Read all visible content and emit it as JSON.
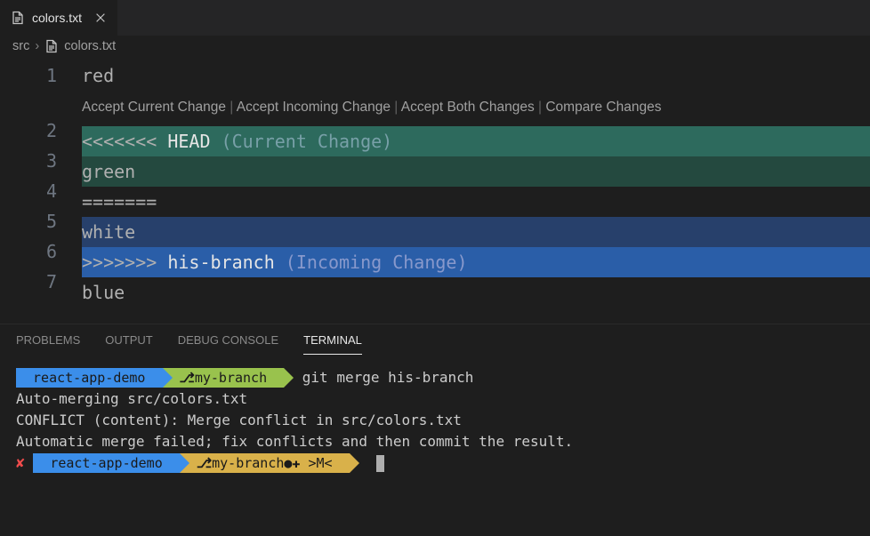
{
  "tab": {
    "filename": "colors.txt"
  },
  "breadcrumb": {
    "folder": "src",
    "file": "colors.txt"
  },
  "codelens": {
    "accept_current": "Accept Current Change",
    "accept_incoming": "Accept Incoming Change",
    "accept_both": "Accept Both Changes",
    "compare": "Compare Changes"
  },
  "editor": {
    "lines": [
      {
        "n": "1",
        "text": "red"
      },
      {
        "n": "2",
        "markers": "<<<<<<< ",
        "ref": "HEAD",
        "annotation": " (Current Change)"
      },
      {
        "n": "3",
        "text": "green"
      },
      {
        "n": "4",
        "text": "======="
      },
      {
        "n": "5",
        "text": "white"
      },
      {
        "n": "6",
        "markers": ">>>>>>> ",
        "ref": "his-branch",
        "annotation": " (Incoming Change)"
      },
      {
        "n": "7",
        "text": "blue"
      }
    ]
  },
  "panel": {
    "tabs": {
      "problems": "PROBLEMS",
      "output": "OUTPUT",
      "debug": "DEBUG CONSOLE",
      "terminal": "TERMINAL"
    }
  },
  "terminal": {
    "prompt1": {
      "project": "react-app-demo",
      "branch_glyph": "⎇",
      "branch": "my-branch",
      "command": "git merge his-branch"
    },
    "output_line1": "Auto-merging src/colors.txt",
    "output_line2": "CONFLICT (content): Merge conflict in src/colors.txt",
    "output_line3": "Automatic merge failed; fix conflicts and then commit the result.",
    "prompt2": {
      "status_glyph": "✘",
      "project": "react-app-demo",
      "branch_glyph": "⎇",
      "branch": "my-branch",
      "dirty": "●✚ >M<"
    }
  }
}
